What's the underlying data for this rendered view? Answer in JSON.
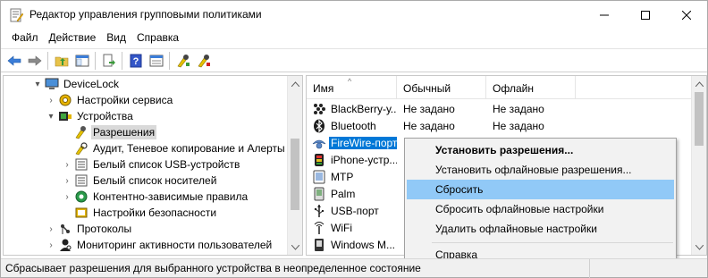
{
  "window": {
    "title": "Редактор управления групповыми политиками"
  },
  "menu": {
    "items": [
      "Файл",
      "Действие",
      "Вид",
      "Справка"
    ]
  },
  "toolbar": {
    "icons": [
      "back-arrow-icon",
      "forward-arrow-icon",
      "up-folder-icon",
      "show-hide-tree-icon",
      "export-list-icon",
      "help-icon",
      "properties-icon",
      "devicelock-icon-1",
      "devicelock-icon-2"
    ]
  },
  "tree": {
    "items": [
      {
        "label": "DeviceLock",
        "expander": "▾",
        "icon": "computer-icon"
      },
      {
        "label": "Настройки сервиса",
        "expander": "›",
        "icon": "gear-icon"
      },
      {
        "label": "Устройства",
        "expander": "▾",
        "icon": "devices-icon"
      },
      {
        "label": "Разрешения",
        "expander": "",
        "icon": "permissions-icon"
      },
      {
        "label": "Аудит, Теневое копирование и Алерты",
        "expander": "",
        "icon": "audit-icon"
      },
      {
        "label": "Белый список USB-устройств",
        "expander": "›",
        "icon": "usb-whitelist-icon"
      },
      {
        "label": "Белый список носителей",
        "expander": "›",
        "icon": "media-whitelist-icon"
      },
      {
        "label": "Контентно-зависимые правила",
        "expander": "›",
        "icon": "content-rules-icon"
      },
      {
        "label": "Настройки безопасности",
        "expander": "",
        "icon": "security-settings-icon"
      },
      {
        "label": "Протоколы",
        "expander": "›",
        "icon": "protocols-icon"
      },
      {
        "label": "Мониторинг активности пользователей",
        "expander": "›",
        "icon": "user-activity-icon"
      }
    ],
    "selected_index": 3
  },
  "list": {
    "columns": [
      "Имя",
      "Обычный",
      "Офлайн"
    ],
    "rows": [
      {
        "name": "BlackBerry-у...",
        "normal": "Не задано",
        "offline": "Не задано",
        "icon": "blackberry-icon"
      },
      {
        "name": "Bluetooth",
        "normal": "Не задано",
        "offline": "Не задано",
        "icon": "bluetooth-icon"
      },
      {
        "name": "FireWire-порт",
        "normal": "",
        "offline": "",
        "icon": "firewire-icon"
      },
      {
        "name": "iPhone-устр...",
        "normal": "",
        "offline": "",
        "icon": "iphone-icon"
      },
      {
        "name": "MTP",
        "normal": "",
        "offline": "",
        "icon": "mtp-icon"
      },
      {
        "name": "Palm",
        "normal": "",
        "offline": "",
        "icon": "palm-icon"
      },
      {
        "name": "USB-порт",
        "normal": "",
        "offline": "",
        "icon": "usb-port-icon"
      },
      {
        "name": "WiFi",
        "normal": "",
        "offline": "",
        "icon": "wifi-icon"
      },
      {
        "name": "Windows M...",
        "normal": "",
        "offline": "",
        "icon": "windows-mobile-icon"
      }
    ],
    "selected_index": 2
  },
  "context_menu": {
    "items": [
      {
        "label": "Установить разрешения...",
        "bold": true
      },
      {
        "label": "Установить офлайновые разрешения..."
      },
      {
        "label": "Сбросить",
        "highlighted": true
      },
      {
        "label": "Сбросить офлайновые настройки"
      },
      {
        "label": "Удалить офлайновые настройки"
      },
      {
        "label": "Справка"
      }
    ]
  },
  "status": {
    "text": "Сбрасывает разрешения для выбранного устройства в неопределенное состояние"
  },
  "colors": {
    "selection": "#0078d7",
    "menu_highlight": "#91c9f7",
    "tree_selection": "#d9d9d9"
  }
}
